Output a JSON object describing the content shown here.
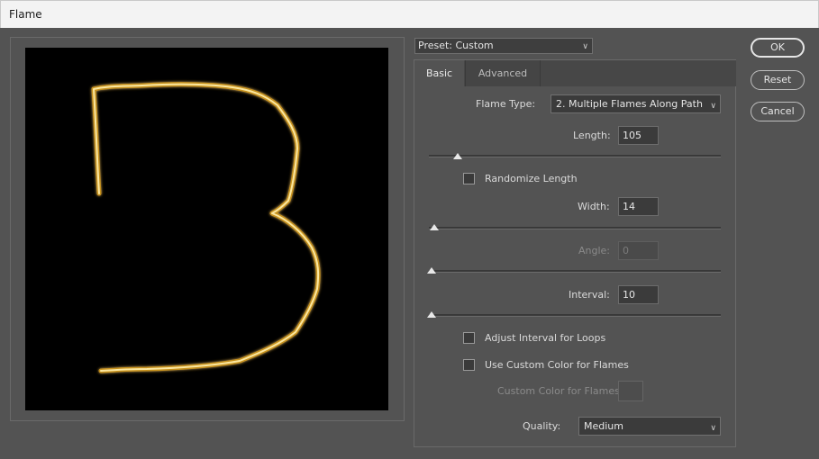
{
  "window": {
    "title": "Flame"
  },
  "preset": {
    "label": "Preset: Custom"
  },
  "tabs": [
    {
      "label": "Basic"
    },
    {
      "label": "Advanced"
    }
  ],
  "flame_type": {
    "label": "Flame Type:",
    "value": "2. Multiple Flames Along Path"
  },
  "length": {
    "label": "Length:",
    "value": "105",
    "slider": 0.09
  },
  "randomize_length": {
    "label": "Randomize Length",
    "checked": false
  },
  "width": {
    "label": "Width:",
    "value": "14",
    "slider": 0.01
  },
  "angle": {
    "label": "Angle:",
    "value": "0",
    "slider": 0.0,
    "disabled": true
  },
  "interval": {
    "label": "Interval:",
    "value": "10",
    "slider": 0.0
  },
  "adjust_interval": {
    "label": "Adjust Interval for Loops",
    "checked": false
  },
  "use_custom_color": {
    "label": "Use Custom Color for Flames",
    "checked": false
  },
  "custom_color": {
    "label": "Custom Color for Flames:",
    "disabled": true
  },
  "quality": {
    "label": "Quality:",
    "value": "Medium"
  },
  "buttons": {
    "ok": "OK",
    "reset": "Reset",
    "cancel": "Cancel"
  },
  "colors": {
    "flame": "#f7d66a",
    "flame_glow": "#c8921e",
    "panel": "#535353",
    "canvas": "#000000"
  }
}
